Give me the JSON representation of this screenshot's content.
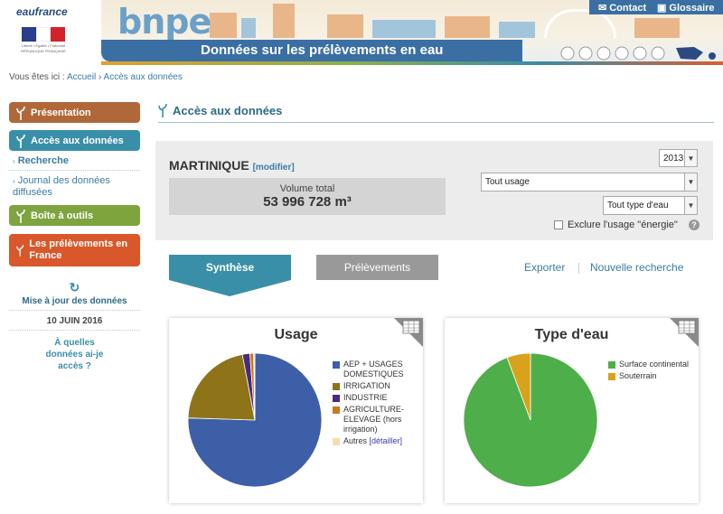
{
  "header": {
    "org_logo": "eaufrance",
    "rep_text": "Liberté • Égalité • Fraternité RÉPUBLIQUE FRANÇAISE",
    "site_logo": "bnpe",
    "site_title": "Données sur les prélèvements en eau",
    "contact_label": "Contact",
    "glossary_label": "Glossaire"
  },
  "breadcrumb": {
    "prefix": "Vous êtes ici :",
    "home": "Accueil",
    "sep": "›",
    "current": "Accès aux données"
  },
  "sidebar": {
    "presentation": "Présentation",
    "access": "Accès aux données",
    "search": "Recherche",
    "journal": "Journal des données diffusées",
    "toolbox": "Boîte à outils",
    "prelevements_fr": "Les prélèvements en France",
    "update_title": "Mise à jour des données",
    "update_date": "10 JUIN 2016",
    "which_data": "À quelles données ai-je accès ?"
  },
  "main": {
    "section_title": "Accès aux données",
    "region": "MARTINIQUE",
    "modify": "[modifier]",
    "volume_label": "Volume total",
    "volume_value": "53 996 728 m³",
    "year": "2013",
    "usage_select": "Tout usage",
    "water_type_select": "Tout type d'eau",
    "exclude_energy": "Exclure l'usage \"énergie\"",
    "help": "?",
    "tab_synthese": "Synthèse",
    "tab_prelevements": "Prélèvements",
    "export": "Exporter",
    "new_search": "Nouvelle recherche"
  },
  "charts": {
    "usage": {
      "title": "Usage",
      "detail": "[détailler]"
    },
    "water_type": {
      "title": "Type d'eau"
    }
  },
  "colors": {
    "presentation": "#b0683a",
    "access": "#3a8fa8",
    "toolbox": "#7ea43e",
    "prelevements_fr": "#d8582b",
    "banner_blue": "#3b6fa3"
  },
  "chart_data": [
    {
      "type": "pie",
      "title": "Usage",
      "slices": [
        {
          "label": "AEP + USAGES DOMESTIQUES",
          "value": 75.5,
          "color": "#3d5fa8"
        },
        {
          "label": "IRRIGATION",
          "value": 21.5,
          "color": "#8f7318"
        },
        {
          "label": "INDUSTRIE",
          "value": 1.8,
          "color": "#4a2a7a"
        },
        {
          "label": "AGRICULTURE-ELEVAGE (hors irrigation)",
          "value": 0.9,
          "color": "#c87a1e"
        },
        {
          "label": "Autres",
          "value": 0.3,
          "color": "#f6ddb0"
        }
      ]
    },
    {
      "type": "pie",
      "title": "Type d'eau",
      "slices": [
        {
          "label": "Surface continental",
          "value": 94.3,
          "color": "#4eae4a"
        },
        {
          "label": "Souterrain",
          "value": 5.7,
          "color": "#d9a21c"
        }
      ]
    }
  ]
}
